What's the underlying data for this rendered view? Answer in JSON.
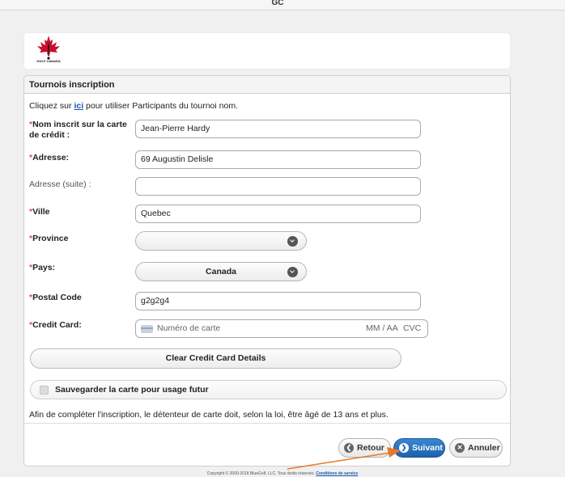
{
  "window": {
    "title": "GC"
  },
  "brand": {
    "logo_text": "GOLF CANADA"
  },
  "panel": {
    "title": "Tournois inscription",
    "intro_before": "Cliquez sur ",
    "intro_link": "ici",
    "intro_after": " pour utiliser Participants du tournoi nom."
  },
  "form": {
    "name": {
      "label": "Nom inscrit sur la carte de crédit :",
      "value": "Jean-Pierre Hardy"
    },
    "address": {
      "label": "Adresse:",
      "value": "69 Augustin Delisle"
    },
    "address2": {
      "label": "Adresse (suite) :",
      "value": ""
    },
    "city": {
      "label": "Ville",
      "value": "Quebec"
    },
    "province": {
      "label": "Province",
      "value": ""
    },
    "country": {
      "label": "Pays:",
      "value": "Canada"
    },
    "postal": {
      "label": "Postal Code",
      "value": "g2g2g4"
    },
    "card": {
      "label": "Credit Card:",
      "number_placeholder": "Numéro de carte",
      "exp_placeholder": "MM / AA",
      "cvc_placeholder": "CVC"
    },
    "required_mark": "*"
  },
  "buttons": {
    "clear_card": "Clear Credit Card Details",
    "save_card": "Sauvegarder la carte pour usage futur",
    "back": "Retour",
    "next": "Suivant",
    "cancel": "Annuler"
  },
  "notice": "Afin de compléter l'inscription, le détenteur de carte doit, selon la loi, être âgé de 13 ans et plus.",
  "footer": {
    "copyright": "Copyright © 2000-2018 BlueGolf, LLC. Tous droits réservés.",
    "terms_link": "Conditions de service"
  },
  "colors": {
    "required": "#d9534f",
    "primary_button": "#1c62ad",
    "annotation_arrow": "#e8792b",
    "logo_red": "#c8102e"
  }
}
